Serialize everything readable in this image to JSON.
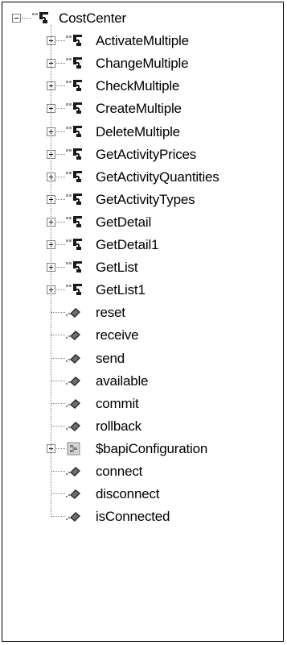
{
  "tree": {
    "root": {
      "label": "CostCenter",
      "icon": "class-node-icon",
      "state": "expanded"
    },
    "children": [
      {
        "label": "ActivateMultiple",
        "icon": "class-node-icon",
        "state": "collapsed"
      },
      {
        "label": "ChangeMultiple",
        "icon": "class-node-icon",
        "state": "collapsed"
      },
      {
        "label": "CheckMultiple",
        "icon": "class-node-icon",
        "state": "collapsed"
      },
      {
        "label": "CreateMultiple",
        "icon": "class-node-icon",
        "state": "collapsed"
      },
      {
        "label": "DeleteMultiple",
        "icon": "class-node-icon",
        "state": "collapsed"
      },
      {
        "label": "GetActivityPrices",
        "icon": "class-node-icon",
        "state": "collapsed"
      },
      {
        "label": "GetActivityQuantities",
        "icon": "class-node-icon",
        "state": "collapsed"
      },
      {
        "label": "GetActivityTypes",
        "icon": "class-node-icon",
        "state": "collapsed"
      },
      {
        "label": "GetDetail",
        "icon": "class-node-icon",
        "state": "collapsed"
      },
      {
        "label": "GetDetail1",
        "icon": "class-node-icon",
        "state": "collapsed"
      },
      {
        "label": "GetList",
        "icon": "class-node-icon",
        "state": "collapsed"
      },
      {
        "label": "GetList1",
        "icon": "class-node-icon",
        "state": "collapsed"
      },
      {
        "label": "reset",
        "icon": "method-icon",
        "state": "leaf"
      },
      {
        "label": "receive",
        "icon": "method-icon",
        "state": "leaf"
      },
      {
        "label": "send",
        "icon": "method-icon",
        "state": "leaf"
      },
      {
        "label": "available",
        "icon": "method-icon",
        "state": "leaf"
      },
      {
        "label": "commit",
        "icon": "method-icon",
        "state": "leaf"
      },
      {
        "label": "rollback",
        "icon": "method-icon",
        "state": "leaf"
      },
      {
        "label": "$bapiConfiguration",
        "icon": "configuration-icon",
        "state": "collapsed"
      },
      {
        "label": "connect",
        "icon": "method-icon",
        "state": "leaf"
      },
      {
        "label": "disconnect",
        "icon": "method-icon",
        "state": "leaf"
      },
      {
        "label": "isConnected",
        "icon": "method-icon",
        "state": "leaf"
      }
    ]
  }
}
